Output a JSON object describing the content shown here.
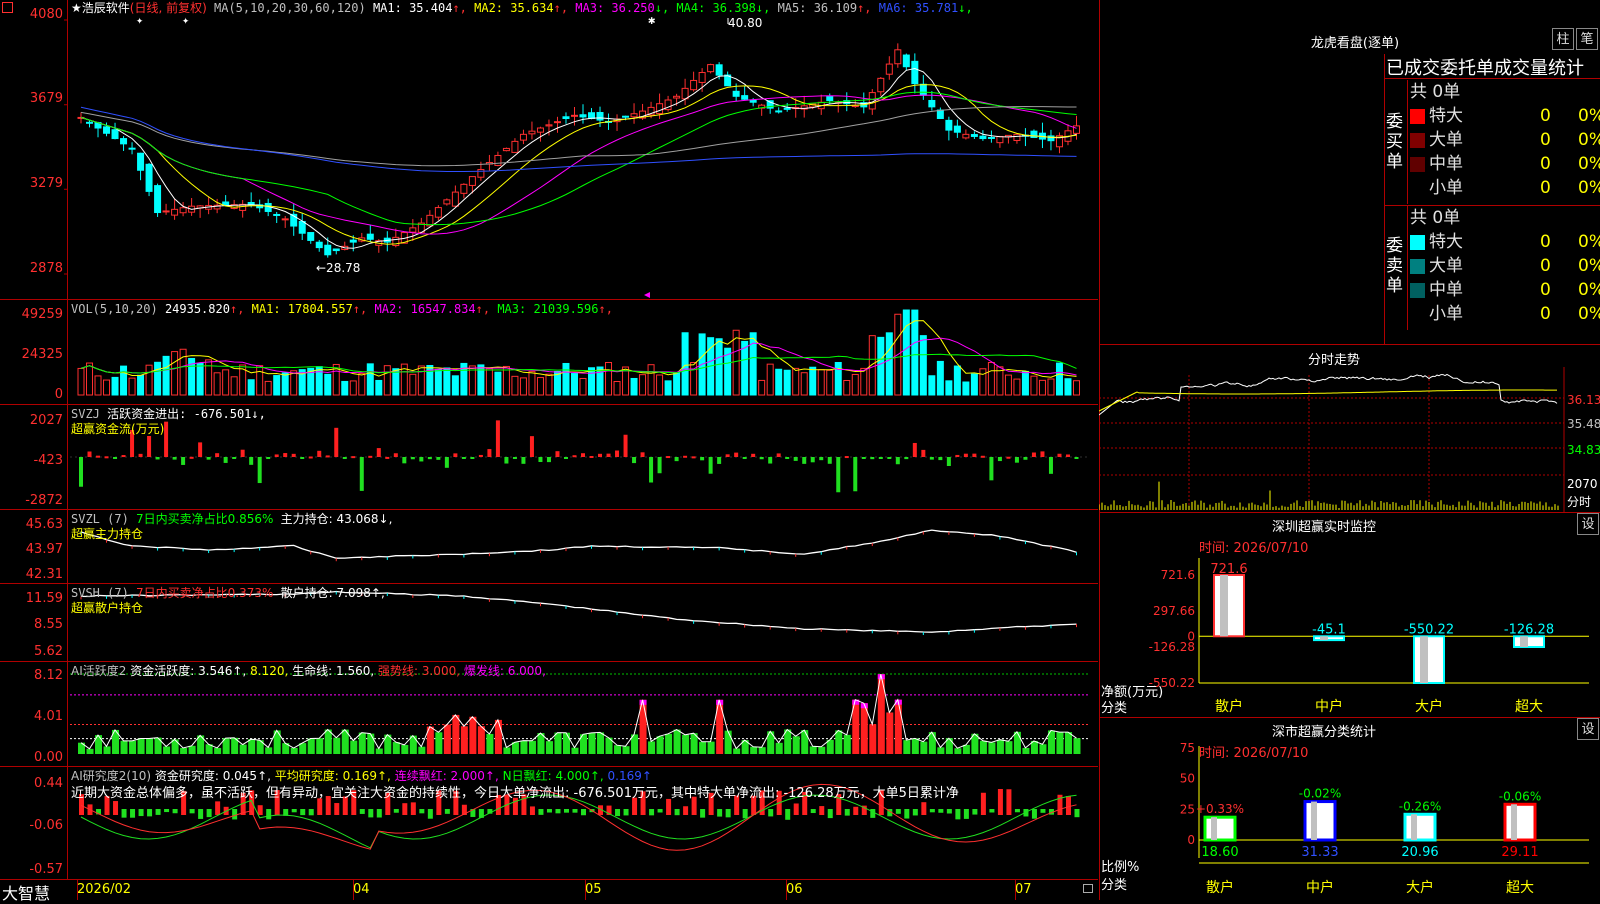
{
  "main": {
    "title": "★浩辰软件",
    "mode": "(日线, 前复权)",
    "ma_header": "MA(5,10,20,30,60,120)",
    "ma": [
      {
        "label": "MA1:",
        "value": "35.404",
        "arrow": "↑",
        "color": "#ffffff"
      },
      {
        "label": "MA2:",
        "value": "35.634",
        "arrow": "↑",
        "color": "#ffff00"
      },
      {
        "label": "MA3:",
        "value": "36.250",
        "arrow": "↓",
        "color": "#ff00ff"
      },
      {
        "label": "MA4:",
        "value": "36.398",
        "arrow": "↓",
        "color": "#00ff00"
      },
      {
        "label": "MA5:",
        "value": "36.109",
        "arrow": "↑",
        "color": "#c0c0c0"
      },
      {
        "label": "MA6:",
        "value": "35.781",
        "arrow": "↓",
        "color": "#3050ff"
      }
    ],
    "y_labels": [
      "4080",
      "3679",
      "3279",
      "2878"
    ],
    "high_label": "40.80",
    "low_label": "←28.78"
  },
  "vol": {
    "header": "VOL(5,10,20)",
    "value": "24935.820",
    "ma": [
      {
        "label": "MA1:",
        "value": "17804.557",
        "arrow": "↑",
        "color": "#ffff00"
      },
      {
        "label": "MA2:",
        "value": "16547.834",
        "arrow": "↑",
        "color": "#ff00ff"
      },
      {
        "label": "MA3:",
        "value": "21039.596",
        "arrow": "↑",
        "color": "#00ff00"
      }
    ],
    "y_labels": [
      "49259",
      "24325",
      "0"
    ]
  },
  "svzj": {
    "header": "SVZJ",
    "line1": "活跃资金进出: -676.501↓,",
    "line2": "超赢资金流(万元)",
    "y_labels": [
      "2027",
      "-423",
      "-2872"
    ]
  },
  "svzl": {
    "header": "SVZL (7)",
    "part1": "7日内买卖净占比0.856%",
    "part2": "主力持仓: 43.068↓,",
    "line2": "超赢主力持仓",
    "y_labels": [
      "45.63",
      "43.97",
      "42.31"
    ]
  },
  "svsh": {
    "header": "SVSH (7)",
    "part1": "7日内买卖净占比0.373%",
    "part2": "散户持仓: 7.098↑,",
    "line2": "超赢散户持仓",
    "y_labels": [
      "11.59",
      "8.55",
      "5.62"
    ]
  },
  "ai1": {
    "header": "AI活跃度2",
    "p1": "资金活跃度: 3.546↑,",
    "p2": "8.120,",
    "p3": "生命线: 1.560,",
    "p4": "强势线: 3.000,",
    "p5": "爆发线: 6.000,",
    "y_labels": [
      "8.12",
      "4.01",
      "0.00"
    ]
  },
  "ai2": {
    "header": "AI研究度2(10)",
    "p1": "资金研究度: 0.045↑,",
    "p2": "平均研究度: 0.169↑,",
    "p3": "连续飘红: 2.000↑,",
    "p4": "N日飘红: 4.000↑,",
    "p5": "0.169↑",
    "comment": "近期大资金总体偏多，虽不活跃，但有异动，宜关注大资金的持续性，今日大单净流出: -676.501万元，其中特大单净流出: -126.28万元，大单5日累计净",
    "y_labels": [
      "0.44",
      "-0.06",
      "-0.57"
    ]
  },
  "xaxis": {
    "brand": "大智慧",
    "labels": [
      "2026/02",
      "04",
      "05",
      "06",
      "07"
    ]
  },
  "right": {
    "lhb": {
      "title": "龙虎看盘(逐单)",
      "btn1": "柱",
      "btn2": "笔"
    },
    "stats_title": "已成交委托单成交量统计",
    "buy": {
      "side_label": "委买单",
      "total": "共 0单",
      "rows": [
        {
          "label": "特大",
          "value": "0",
          "pct": "0%",
          "color": "#ff0000"
        },
        {
          "label": "大单",
          "value": "0",
          "pct": "0%",
          "color": "#800000"
        },
        {
          "label": "中单",
          "value": "0",
          "pct": "0%",
          "color": "#600000"
        },
        {
          "label": "小单",
          "value": "0",
          "pct": "0%",
          "color": "#000000"
        }
      ]
    },
    "sell": {
      "side_label": "委卖单",
      "total": "共 0单",
      "rows": [
        {
          "label": "特大",
          "value": "0",
          "pct": "0%",
          "color": "#00ffff"
        },
        {
          "label": "大单",
          "value": "0",
          "pct": "0%",
          "color": "#008080"
        },
        {
          "label": "中单",
          "value": "0",
          "pct": "0%",
          "color": "#006060"
        },
        {
          "label": "小单",
          "value": "0",
          "pct": "0%",
          "color": "#000000"
        }
      ]
    },
    "intraday": {
      "title": "分时走势",
      "y_labels": [
        "36.13",
        "35.48",
        "34.83"
      ],
      "vol_label": "2070",
      "vol_unit": "分时"
    },
    "monitor": {
      "title": "深圳超赢实时监控",
      "btn": "设",
      "time": "时间: 2026/07/10",
      "y_labels": [
        "721.6",
        "297.66",
        "0",
        "-126.28",
        "-550.22"
      ],
      "axis_title": "净额(万元)",
      "axis_sub": "分类",
      "bars": [
        {
          "name": "散户",
          "value": 721.6,
          "label": "721.6"
        },
        {
          "name": "中户",
          "value": -45.1,
          "label": "-45.1"
        },
        {
          "name": "大户",
          "value": -550.22,
          "label": "-550.22"
        },
        {
          "name": "超大",
          "value": -126.28,
          "label": "-126.28"
        }
      ]
    },
    "classify": {
      "title": "深市超赢分类统计",
      "btn": "设",
      "time": "时间: 2026/07/10",
      "y_labels": [
        "75",
        "50",
        "25",
        "0"
      ],
      "axis_title": "比例%",
      "axis_sub": "分类",
      "bars": [
        {
          "name": "散户",
          "value": 18.6,
          "label": "18.60",
          "change": "+0.33%",
          "color": "#00ff00"
        },
        {
          "name": "中户",
          "value": 31.33,
          "label": "31.33",
          "change": "-0.02%",
          "color": "#0000ff"
        },
        {
          "name": "大户",
          "value": 20.96,
          "label": "20.96",
          "change": "-0.26%",
          "color": "#00ffff"
        },
        {
          "name": "超大",
          "value": 29.11,
          "label": "29.11",
          "change": "-0.06%",
          "color": "#ff0000"
        }
      ]
    }
  },
  "chart_data": [
    {
      "type": "candlestick",
      "title": "浩辰软件 (日线, 前复权)",
      "ylim": [
        28.78,
        40.8
      ],
      "y_ticks": [
        40.8,
        36.79,
        32.79,
        28.78
      ],
      "high": 40.8,
      "low": 28.78,
      "ma_values": {
        "MA1": 35.404,
        "MA2": 35.634,
        "MA3": 36.25,
        "MA4": 36.398,
        "MA5": 36.109,
        "MA6": 35.781
      },
      "x_labels": [
        "2026/02",
        "04",
        "05",
        "06",
        "07"
      ]
    },
    {
      "type": "bar",
      "title": "深圳超赢实时监控",
      "categories": [
        "散户",
        "中户",
        "大户",
        "超大"
      ],
      "values": [
        721.6,
        -45.1,
        -550.22,
        -126.28
      ],
      "ylabel": "净额(万元)"
    },
    {
      "type": "bar",
      "title": "深市超赢分类统计",
      "categories": [
        "散户",
        "中户",
        "大户",
        "超大"
      ],
      "values": [
        18.6,
        31.33,
        20.96,
        29.11
      ],
      "changes": [
        "+0.33%",
        "-0.02%",
        "-0.26%",
        "-0.06%"
      ],
      "ylabel": "比例%",
      "ylim": [
        0,
        75
      ]
    }
  ]
}
